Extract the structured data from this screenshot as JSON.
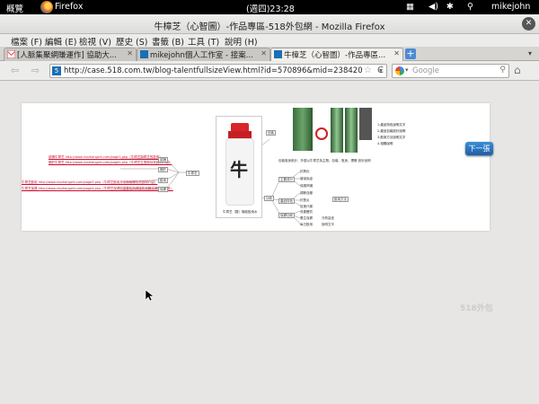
{
  "topbar": {
    "activities": "概覽",
    "app": "Firefox",
    "clock": "(週四)23:28",
    "user": "mikejohn"
  },
  "window": {
    "title": "牛樟芝（心智圖）-作品專區-518外包網 - Mozilla Firefox"
  },
  "menu": [
    "檔案 (F)",
    "編輯 (E)",
    "檢視 (V)",
    "歷史 (S)",
    "書籤 (B)",
    "工具 (T)",
    "說明 (H)"
  ],
  "tabs": [
    {
      "label": "[人脈集聚網賺運作] 協助大..."
    },
    {
      "label": "mikejohn個人工作室 - 接案..."
    },
    {
      "label": "牛樟芝（心智圖）-作品專區..."
    }
  ],
  "nav": {
    "url": "http://case.518.com.tw/blog-talentfullsizeView.html?id=570896&mid=238420",
    "search_placeholder": "Google"
  },
  "mindmap": {
    "product_caption": "牛樟芝（酸）機能飲用水",
    "center_label": "牛樟芝",
    "left_links": [
      "認識牛樟芝 http://www.niuzhangzhi.com/page1.php（牛樟芝與樟芝的區別）",
      "關於牛樟芝 http://www.niuzhangzhi.com/page2.php（牛樟芝生態與功效說明介紹）",
      "牛樟芝飲用 http://www.niuzhangzhi.com/page3.php（牛樟芝飲用方法與相關功效說明介紹）",
      "牛樟芝保健 http://www.niuzhangzhi.com/page4.php（牛樟芝保健的重要性與健康的相關保健知識說明）"
    ],
    "left_branches": [
      "認識",
      "關於",
      "飲用",
      "保健"
    ],
    "right_top_label": "包裝",
    "note_lines": [
      "1.產品特色說明文字",
      "2.產品包裝設計說明",
      "3.飲用方法說明文字",
      "4.相關說明"
    ],
    "photo_caption": "包裝瓶身設計，外觀以牛樟芝為主題，包裝、瓶身、標籤 設計說明",
    "mid_label": "功效",
    "right_groups": [
      "主要成分",
      "產品特色",
      "保健功效",
      "飲用方法"
    ],
    "right_items": [
      "抗氧化",
      "增強免疫",
      "保護肝臟",
      "調節血壓",
      "抗發炎",
      "促進代謝",
      "改善體質",
      "養生保健",
      "每日飲用",
      "冷熱皆宜",
      "說明文字"
    ]
  },
  "next_button": "下一張",
  "watermark": "518外包"
}
